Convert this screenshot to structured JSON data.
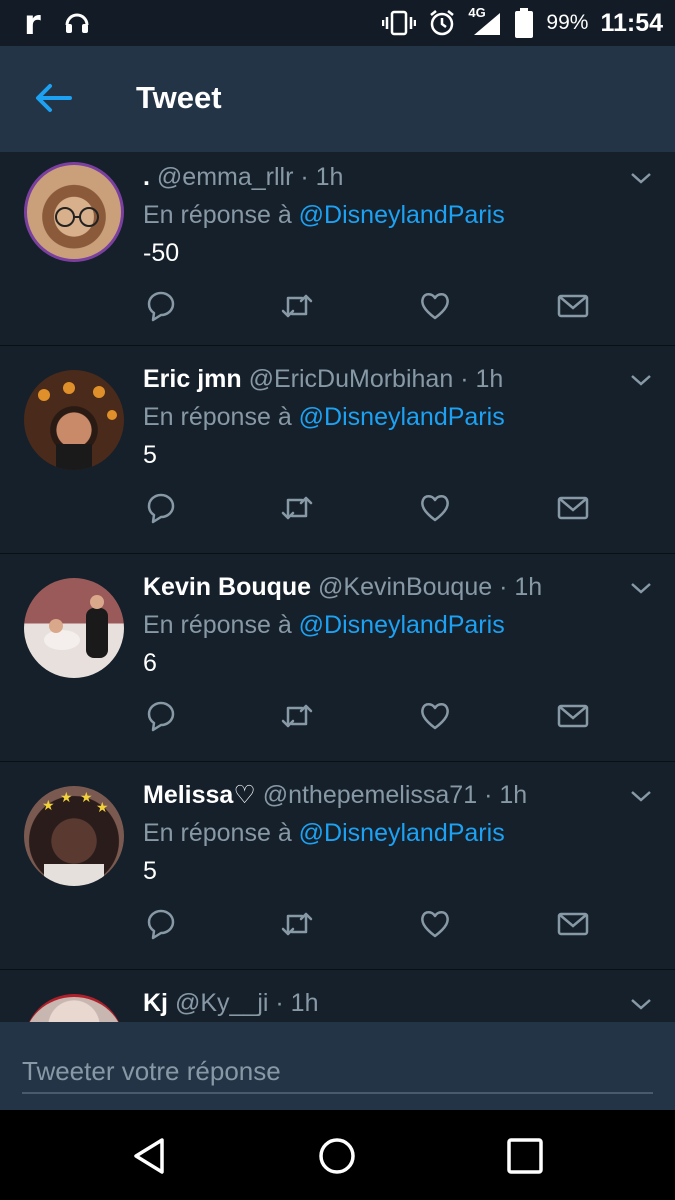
{
  "status_bar": {
    "network": "4G",
    "battery": "99%",
    "time": "11:54"
  },
  "header": {
    "title": "Tweet"
  },
  "replies": [
    {
      "name": ".",
      "handle": "@emma_rllr",
      "time": "1h",
      "reply_prefix": "En réponse à",
      "mention": "@DisneylandParis",
      "text": "-50",
      "avatar_colors": [
        "#c9a07a",
        "#5b2d4f"
      ]
    },
    {
      "name": "Eric jmn",
      "handle": "@EricDuMorbihan",
      "time": "1h",
      "reply_prefix": "En réponse à",
      "mention": "@DisneylandParis",
      "text": "5",
      "avatar_colors": [
        "#4a2a1a",
        "#d08a3a"
      ]
    },
    {
      "name": "Kevin Bouque",
      "handle": "@KevinBouque",
      "time": "1h",
      "reply_prefix": "En réponse à",
      "mention": "@DisneylandParis",
      "text": "6",
      "avatar_colors": [
        "#8a4a4a",
        "#e8e0dc"
      ]
    },
    {
      "name": "Melissa♡",
      "handle": "@nthepemelissa71",
      "time": "1h",
      "reply_prefix": "En réponse à",
      "mention": "@DisneylandParis",
      "text": "5",
      "avatar_colors": [
        "#2a1c1a",
        "#7a5a50"
      ]
    },
    {
      "name": "Kj",
      "handle": "@Ky__ji",
      "time": "1h",
      "avatar_colors": [
        "#c8b6b0",
        "#8a6e6a"
      ]
    }
  ],
  "reply_box": {
    "placeholder": "Tweeter votre réponse"
  },
  "colors": {
    "background": "#15202b",
    "header": "#243447",
    "accent": "#1da1f2",
    "secondary_text": "#8899a6"
  }
}
